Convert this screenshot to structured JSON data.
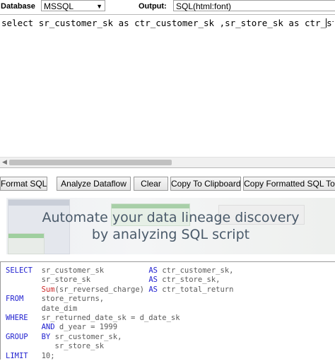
{
  "toolbar": {
    "database_label": "Database",
    "database_value": "MSSQL",
    "output_label": "Output:",
    "output_value": "SQL(html:font)",
    "dropdown_arrow": "▼"
  },
  "editor": {
    "p1": "select ",
    "p2": "sr_customer_sk",
    "p3": " as ",
    "p4": "ctr_customer_sk",
    "p5": " ,",
    "p6": "sr_store_sk",
    "p7": " as ctr_",
    "p8": "store_"
  },
  "scrollbar": {
    "left_arrow": "◀"
  },
  "buttons": {
    "format": "Format SQL",
    "analyze": "Analyze Dataflow",
    "clear": "Clear",
    "copy": "Copy To Clipboard",
    "copy_formatted": "Copy Formatted SQL To"
  },
  "banner": {
    "line1": "Automate your data lineage discovery",
    "line2": "by analyzing SQL script"
  },
  "output": {
    "l1_kw": "SELECT",
    "l1_id": "sr_customer_sk",
    "l1_as": "AS",
    "l1_alias": "ctr_customer_sk,",
    "l2_id": "sr_store_sk",
    "l2_as": "AS",
    "l2_alias": "ctr_store_sk,",
    "l3_fn": "Sum",
    "l3_arg": "(sr_reversed_charge)",
    "l3_as": "AS",
    "l3_alias": "ctr_total_return",
    "l4_kw": "FROM",
    "l4_id": "store_returns,",
    "l5_id": "date_dim",
    "l6_kw": "WHERE",
    "l6_expr": "sr_returned_date_sk = d_date_sk",
    "l7_and": "AND",
    "l7_expr": "d_year = 1999",
    "l8_kw": "GROUP",
    "l8_by": "BY",
    "l8_id": "sr_customer_sk,",
    "l9_id": "sr_store_sk",
    "l10_kw": "LIMIT",
    "l10_val": "10;"
  }
}
